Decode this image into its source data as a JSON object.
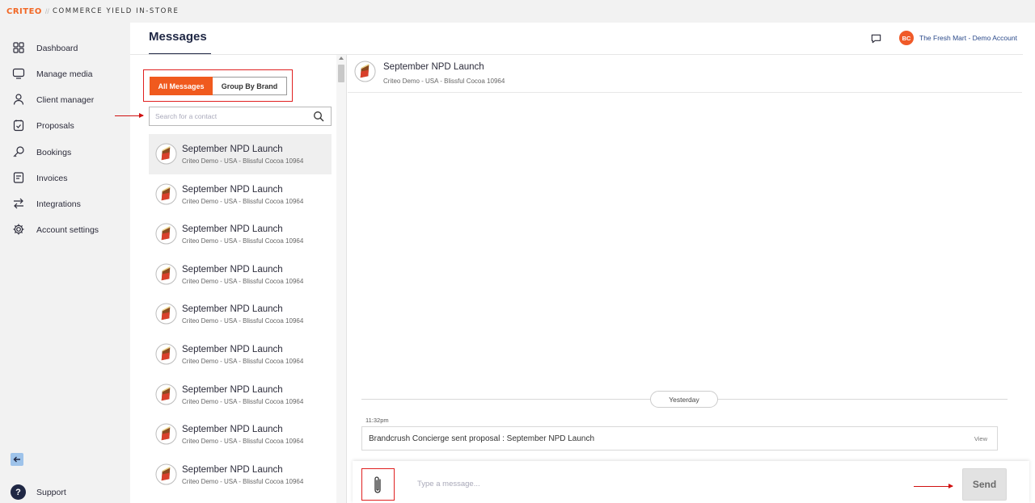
{
  "brand": {
    "logo_text": "CRITEO",
    "separator": "//",
    "product_name": "COMMERCE YIELD IN-STORE",
    "accent_color": "#f05a28"
  },
  "sidebar": {
    "items": [
      {
        "label": "Dashboard",
        "icon": "grid-icon"
      },
      {
        "label": "Manage media",
        "icon": "monitor-icon"
      },
      {
        "label": "Client manager",
        "icon": "user-icon"
      },
      {
        "label": "Proposals",
        "icon": "clipboard-icon"
      },
      {
        "label": "Bookings",
        "icon": "key-icon"
      },
      {
        "label": "Invoices",
        "icon": "receipt-icon"
      },
      {
        "label": "Integrations",
        "icon": "swap-arrows-icon"
      },
      {
        "label": "Account settings",
        "icon": "gear-icon"
      }
    ],
    "support_label": "Support",
    "support_icon_text": "?"
  },
  "header": {
    "title": "Messages",
    "account_initials": "BC",
    "account_name": "The Fresh Mart - Demo Account"
  },
  "filters": {
    "all_label": "All Messages",
    "brand_label": "Group By Brand",
    "active": "All Messages"
  },
  "search": {
    "placeholder": "Search for a contact",
    "value": ""
  },
  "conversations": [
    {
      "name": "September NPD Launch",
      "sub": "Criteo Demo - USA - Blissful Cocoa 10964",
      "active": true
    },
    {
      "name": "September NPD Launch",
      "sub": "Criteo Demo - USA - Blissful Cocoa 10964",
      "active": false
    },
    {
      "name": "September NPD Launch",
      "sub": "Criteo Demo - USA - Blissful Cocoa 10964",
      "active": false
    },
    {
      "name": "September NPD Launch",
      "sub": "Criteo Demo - USA - Blissful Cocoa 10964",
      "active": false
    },
    {
      "name": "September NPD Launch",
      "sub": "Criteo Demo - USA - Blissful Cocoa 10964",
      "active": false
    },
    {
      "name": "September NPD Launch",
      "sub": "Criteo Demo - USA - Blissful Cocoa 10964",
      "active": false
    },
    {
      "name": "September NPD Launch",
      "sub": "Criteo Demo - USA - Blissful Cocoa 10964",
      "active": false
    },
    {
      "name": "September NPD Launch",
      "sub": "Criteo Demo - USA - Blissful Cocoa 10964",
      "active": false
    },
    {
      "name": "September NPD Launch",
      "sub": "Criteo Demo - USA - Blissful Cocoa 10964",
      "active": false
    }
  ],
  "chat": {
    "title": "September NPD Launch",
    "sub": "Criteo Demo - USA - Blissful Cocoa 10964",
    "day_label": "Yesterday",
    "messages": [
      {
        "time": "11:32pm",
        "text": "Brandcrush Concierge sent proposal : September NPD Launch",
        "action": "View"
      }
    ],
    "input_placeholder": "Type a message...",
    "input_value": "",
    "send_label": "Send"
  }
}
